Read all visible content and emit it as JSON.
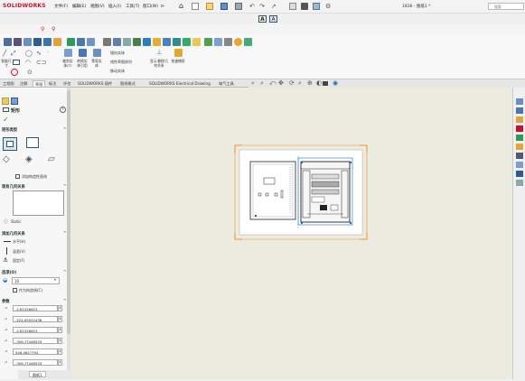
{
  "app": {
    "logo": "SOLIDWORKS",
    "doc_title": "1836 - 图纸1 *",
    "help_search_placeholder": "搜索"
  },
  "menu": [
    "文件(F)",
    "编辑(E)",
    "视图(V)",
    "插入(I)",
    "工具(T)",
    "窗口(W)"
  ],
  "ribbon": {
    "labels": {
      "smart_dim": "智能尺寸",
      "sketch_fillet_a": "裁剪实体(T)",
      "convert": "转换实体引用",
      "offset": "等距实体",
      "mirror": "镜向实体",
      "linear_pattern": "线性草图阵列",
      "move": "移动实体",
      "display_relations": "显示/删除几何关系",
      "quick_snap": "快速捕捉"
    }
  },
  "tabs": [
    "工程图",
    "注解",
    "草图",
    "标注",
    "评估",
    "SOLIDWORKS 插件",
    "图纸格式",
    "SOLIDWORKS Electrical Drawing",
    "电气工具"
  ],
  "active_tab_index": 2,
  "left_panel": {
    "title": "矩形",
    "rect_type_header": "矩形类型",
    "construction_label": "添加构造性直线",
    "existing_relations_header": "现有几何关系",
    "static_label": "Static",
    "add_relations_header": "添加几何关系",
    "horizontal": "水平(H)",
    "vertical": "竖直(V)",
    "fix": "固定(F)",
    "options_header": "选项(O)",
    "options_value": "10",
    "construction_geom": "作为构造线(C)",
    "params_header": "参数",
    "params": [
      "-2.61526623",
      "-224.05052436",
      "-2.61526623",
      "-356.77446533",
      "546.0627794",
      "-356.77446533"
    ]
  },
  "sheet_tabs": [
    "图纸1"
  ],
  "colors": {
    "logo_red": "#c8102e",
    "selection_orange": "#f0902a",
    "canvas_bg": "#ecebe0",
    "accent_blue": "#1a6fc4"
  }
}
